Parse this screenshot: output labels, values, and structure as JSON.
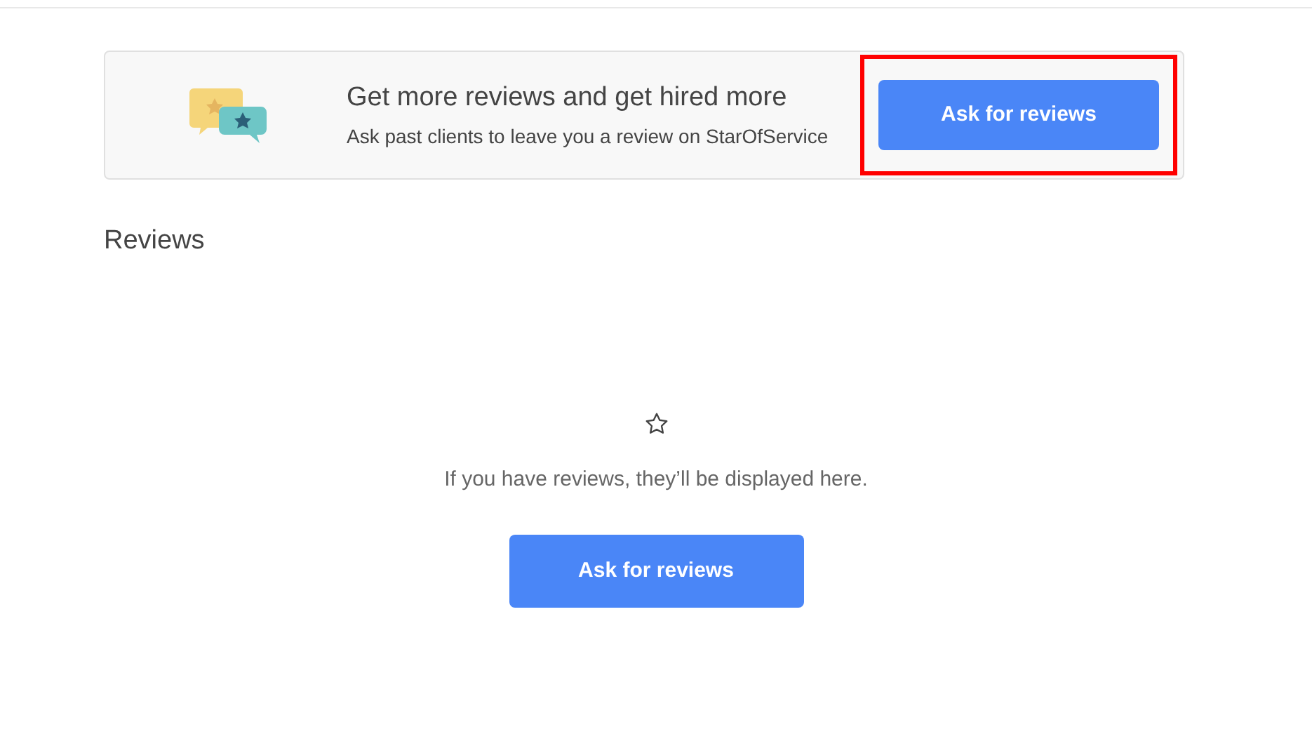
{
  "banner": {
    "title": "Get more reviews and get hired more",
    "subtitle": "Ask past clients to leave you a review on StarOfService",
    "button": {
      "label": "Ask for reviews",
      "highlighted": true
    }
  },
  "reviews": {
    "heading": "Reviews",
    "empty_message": "If you have reviews, they’ll be displayed here.",
    "button": {
      "label": "Ask for reviews"
    }
  }
}
